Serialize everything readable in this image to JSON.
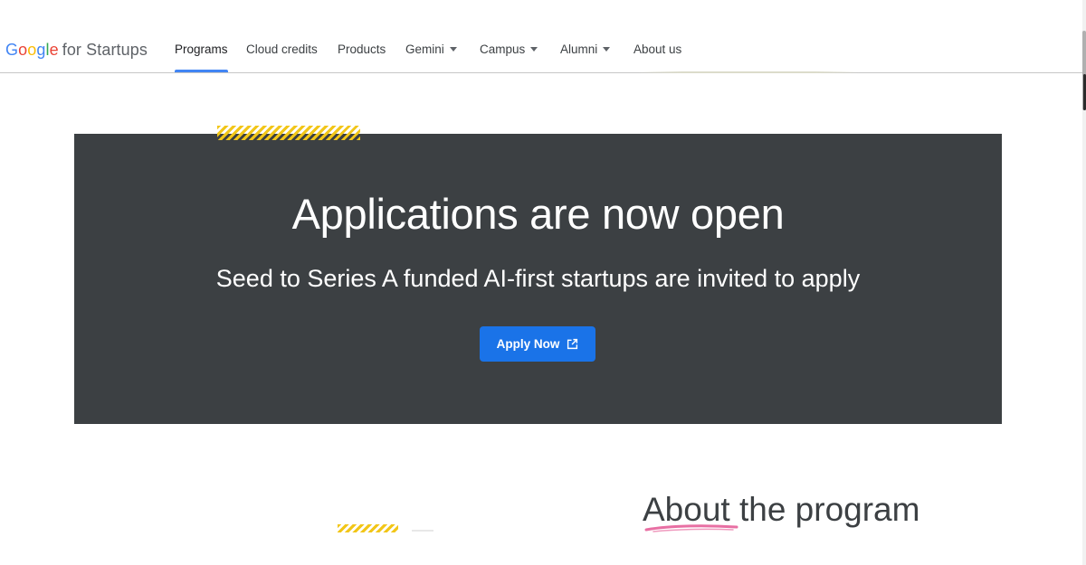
{
  "logo": {
    "google_letters": [
      "G",
      "o",
      "o",
      "g",
      "l",
      "e"
    ],
    "suffix": "for Startups"
  },
  "nav": {
    "items": [
      {
        "label": "Programs",
        "dropdown": false,
        "active": true
      },
      {
        "label": "Cloud credits",
        "dropdown": false,
        "active": false
      },
      {
        "label": "Products",
        "dropdown": false,
        "active": false
      },
      {
        "label": "Gemini",
        "dropdown": true,
        "active": false
      },
      {
        "label": "Campus",
        "dropdown": true,
        "active": false
      },
      {
        "label": "Alumni",
        "dropdown": true,
        "active": false
      },
      {
        "label": "About us",
        "dropdown": false,
        "active": false
      }
    ]
  },
  "hero": {
    "title": "Applications are now open",
    "subtitle": "Seed to Series A funded AI-first startups are invited to apply",
    "cta_label": "Apply Now",
    "cta_icon": "external-link-icon"
  },
  "about": {
    "heading": "About the program"
  },
  "colors": {
    "brand_blue": "#4285f4",
    "brand_red": "#ea4335",
    "brand_yellow": "#fbbc05",
    "brand_green": "#34a853",
    "hero_bg": "#3c4043",
    "button_blue": "#1a73e8",
    "accent_hatch": "#f2c618",
    "underline_pink": "#e86fa3"
  }
}
